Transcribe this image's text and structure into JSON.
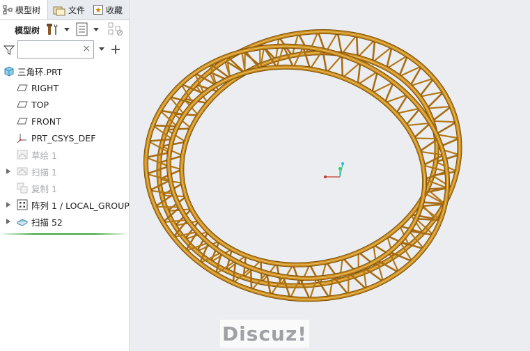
{
  "tabs": [
    {
      "label": "模型树"
    },
    {
      "label": "文件"
    },
    {
      "label": "收藏"
    }
  ],
  "toolbar": {
    "label": "模型树"
  },
  "search": {
    "value": "",
    "clear": "×"
  },
  "tree": {
    "root": "三角环.PRT",
    "items": [
      {
        "label": "RIGHT"
      },
      {
        "label": "TOP"
      },
      {
        "label": "FRONT"
      },
      {
        "label": "PRT_CSYS_DEF"
      },
      {
        "label": "草绘 1"
      },
      {
        "label": "扫描 1"
      },
      {
        "label": "复制 1"
      },
      {
        "label": "阵列 1 / LOCAL_GROUP"
      },
      {
        "label": "扫描 52"
      }
    ]
  },
  "colors": {
    "model": "#c98a1e",
    "viewport_bg": "#ebedf0",
    "insert_line": "#3aa63a"
  },
  "watermark": "Discuz!"
}
